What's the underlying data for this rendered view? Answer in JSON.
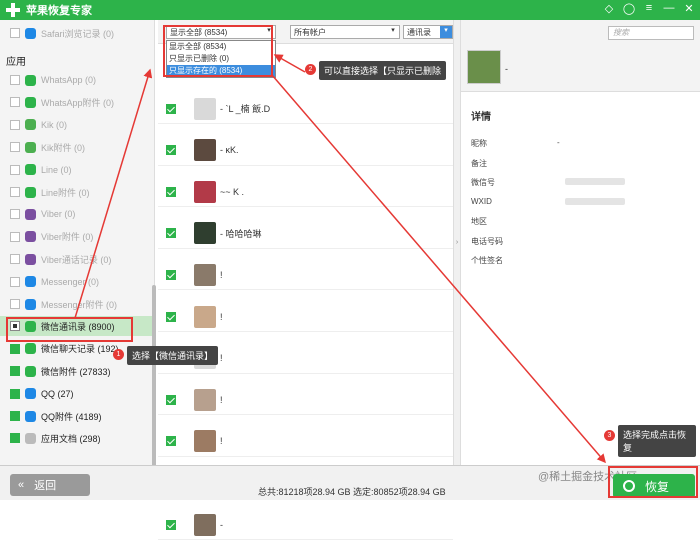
{
  "app": {
    "title": "苹果恢复专家"
  },
  "sidebar": {
    "top_item": "Safari浏览记录 (0)",
    "section": "应用",
    "items": [
      {
        "label": "WhatsApp (0)",
        "color": "#2db34a",
        "state": "off"
      },
      {
        "label": "WhatsApp附件 (0)",
        "color": "#2db34a",
        "state": "off"
      },
      {
        "label": "Kik (0)",
        "color": "#4caf50",
        "state": "off"
      },
      {
        "label": "Kik附件 (0)",
        "color": "#4caf50",
        "state": "off"
      },
      {
        "label": "Line (0)",
        "color": "#2db34a",
        "state": "off"
      },
      {
        "label": "Line附件 (0)",
        "color": "#2db34a",
        "state": "off"
      },
      {
        "label": "Viber (0)",
        "color": "#7b4fa0",
        "state": "off"
      },
      {
        "label": "Viber附件 (0)",
        "color": "#7b4fa0",
        "state": "off"
      },
      {
        "label": "Viber通话记录 (0)",
        "color": "#7b4fa0",
        "state": "off"
      },
      {
        "label": "Messenger (0)",
        "color": "#1e88e5",
        "state": "off"
      },
      {
        "label": "Messenger附件 (0)",
        "color": "#1e88e5",
        "state": "off"
      },
      {
        "label": "微信通讯录 (8900)",
        "color": "#2db34a",
        "state": "active"
      },
      {
        "label": "微信聊天记录 (192)",
        "color": "#2db34a",
        "state": "checked"
      },
      {
        "label": "微信附件 (27833)",
        "color": "#2db34a",
        "state": "checked"
      },
      {
        "label": "QQ (27)",
        "color": "#1e88e5",
        "state": "checked"
      },
      {
        "label": "QQ附件 (4189)",
        "color": "#1e88e5",
        "state": "checked"
      },
      {
        "label": "应用文档 (298)",
        "color": "#bbbbbb",
        "state": "checked"
      }
    ]
  },
  "filter": {
    "show_select": "显示全部 (8534)",
    "account_select": "所有帐户",
    "type_select": "通讯录",
    "options": [
      "显示全部 (8534)",
      "只显示已删除 (0)",
      "只显示存在的 (8534)"
    ]
  },
  "contacts": [
    {
      "name": "- `L _楠 飯.D",
      "color": "#d9d9d9"
    },
    {
      "name": "- κK.",
      "color": "#5c4a3f"
    },
    {
      "name": "~~ K .",
      "color": "#b23a48"
    },
    {
      "name": "- 哈哈哈琳",
      "color": "#2f3e2f"
    },
    {
      "name": "!",
      "color": "#8a7a6a"
    },
    {
      "name": "!",
      "color": "#c9a88a"
    },
    {
      "name": "!",
      "color": "#d9d9d9"
    },
    {
      "name": "!",
      "color": "#b7a08e"
    },
    {
      "name": "!",
      "color": "#9c7b63"
    },
    {
      "name": "!",
      "color": "#a89282"
    },
    {
      "name": "-",
      "color": "#7f6e5e"
    }
  ],
  "detail": {
    "search_placeholder": "搜索",
    "name": "-",
    "heading": "详情",
    "fields": [
      {
        "label": "昵称",
        "value": "-"
      },
      {
        "label": "备注",
        "value": ""
      },
      {
        "label": "微信号",
        "value": ""
      },
      {
        "label": "WXID",
        "value": ""
      },
      {
        "label": "地区",
        "value": ""
      },
      {
        "label": "电话号码",
        "value": ""
      },
      {
        "label": "个性签名",
        "value": ""
      }
    ]
  },
  "bottom": {
    "back_label": "返回",
    "stats": "总共:81218项28.94 GB 选定:80852项28.94 GB",
    "watermark": "@稀土掘金技术社区",
    "restore_label": "恢复"
  },
  "callouts": {
    "c1": {
      "num": "1",
      "text": "选择【微信通讯录】"
    },
    "c2": {
      "num": "2",
      "text": "可以直接选择【只显示已删除"
    },
    "c3": {
      "num": "3",
      "text": "选择完成点击恢复"
    }
  }
}
